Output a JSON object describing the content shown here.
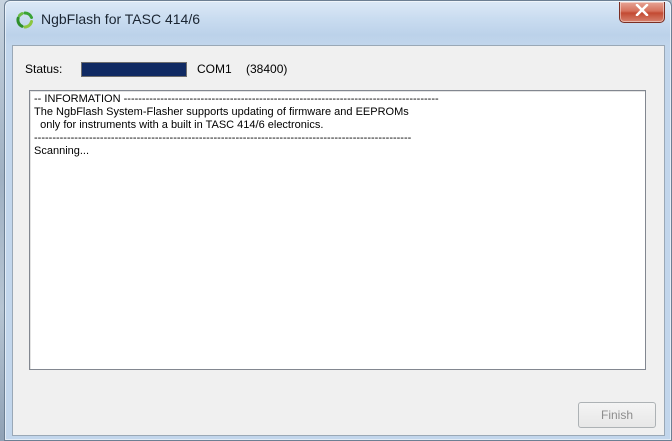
{
  "window": {
    "title": "NgbFlash for TASC 414/6",
    "app_icon": "recycle-arrows-icon",
    "close_icon": "close-x-icon"
  },
  "status": {
    "label": "Status:",
    "progress_fraction": 1.0,
    "port": "COM1",
    "baud": "(38400)"
  },
  "log": {
    "lines": [
      "-- INFORMATION --------------------------------------------------------------------------------------",
      "The NgbFlash System-Flasher supports updating of firmware and EEPROMs",
      "  only for instruments with a built in TASC 414/6 electronics.",
      "-------------------------------------------------------------------------------------------------------",
      "Scanning..."
    ]
  },
  "buttons": {
    "finish_label": "Finish"
  },
  "colors": {
    "progress_fill": "#102a63",
    "close_button": "#c84b34"
  }
}
